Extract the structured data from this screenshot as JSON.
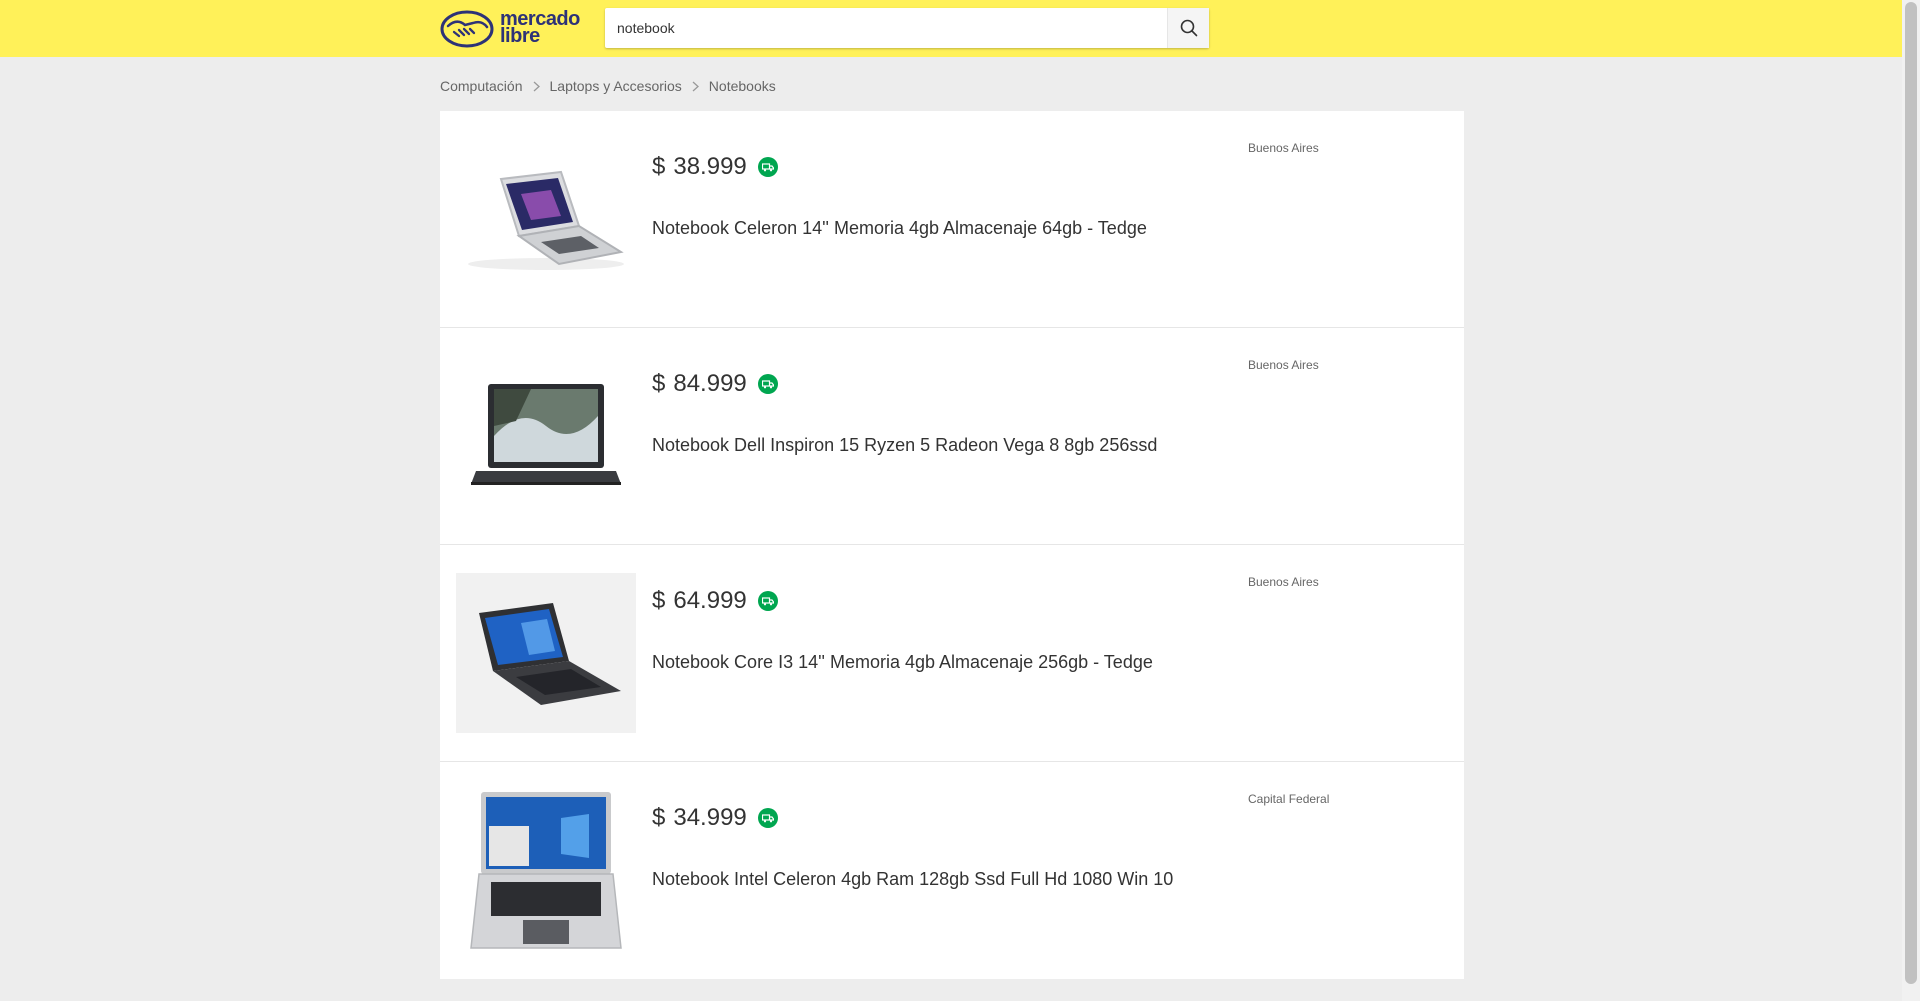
{
  "header": {
    "logo_line1": "mercado",
    "logo_line2": "libre",
    "search": {
      "value": "notebook",
      "placeholder": ""
    }
  },
  "breadcrumb": [
    "Computación",
    "Laptops y Accesorios",
    "Notebooks"
  ],
  "results": [
    {
      "currency": "$",
      "price": "38.999",
      "title": "Notebook Celeron 14'' Memoria 4gb Almacenaje 64gb - Tedge",
      "location": "Buenos Aires"
    },
    {
      "currency": "$",
      "price": "84.999",
      "title": "Notebook Dell Inspiron 15 Ryzen 5 Radeon Vega 8 8gb 256ssd",
      "location": "Buenos Aires"
    },
    {
      "currency": "$",
      "price": "64.999",
      "title": "Notebook Core I3 14'' Memoria 4gb Almacenaje 256gb - Tedge",
      "location": "Buenos Aires"
    },
    {
      "currency": "$",
      "price": "34.999",
      "title": "Notebook Intel Celeron 4gb Ram 128gb Ssd Full Hd 1080 Win 10",
      "location": "Capital Federal"
    }
  ],
  "colors": {
    "header_bg": "#fff159",
    "brand_blue": "#2d3277",
    "shipping_green": "#00a650"
  },
  "icons": {
    "search": "search-icon",
    "shipping": "shipping-truck-icon",
    "breadcrumb_sep": "chevron-right-icon"
  }
}
